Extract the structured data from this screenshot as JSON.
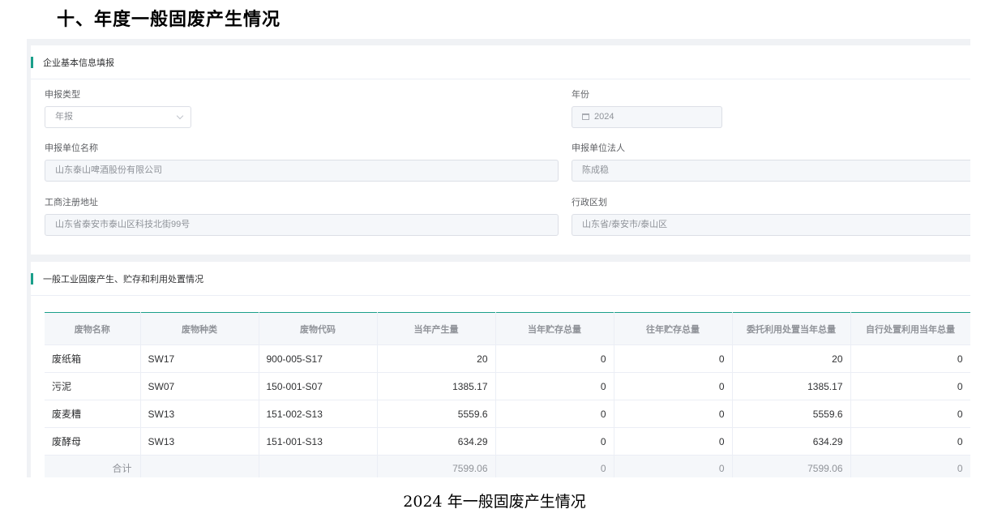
{
  "doc_heading": "十、年度一般固废产生情况",
  "caption": "2024 年一般固废产生情况",
  "basic_card": {
    "title": "企业基本信息填报",
    "report_type": {
      "label": "申报类型",
      "value": "年报"
    },
    "year": {
      "label": "年份",
      "value": "2024"
    },
    "company_name": {
      "label": "申报单位名称",
      "value": "山东泰山啤酒股份有限公司"
    },
    "legal_person": {
      "label": "申报单位法人",
      "value": "陈成稳"
    },
    "address": {
      "label": "工商注册地址",
      "value": "山东省泰安市泰山区科技北街99号"
    },
    "region": {
      "label": "行政区划",
      "value": "山东省/泰安市/泰山区"
    }
  },
  "waste_card": {
    "title": "一般工业固废产生、贮存和利用处置情况",
    "columns": [
      "废物名称",
      "废物种类",
      "废物代码",
      "当年产生量",
      "当年贮存总量",
      "往年贮存总量",
      "委托利用处置当年总量",
      "自行处置利用当年总量"
    ],
    "rows": [
      [
        "废纸箱",
        "SW17",
        "900-005-S17",
        "20",
        "0",
        "0",
        "20",
        "0"
      ],
      [
        "污泥",
        "SW07",
        "150-001-S07",
        "1385.17",
        "0",
        "0",
        "1385.17",
        "0"
      ],
      [
        "废麦糟",
        "SW13",
        "151-002-S13",
        "5559.6",
        "0",
        "0",
        "5559.6",
        "0"
      ],
      [
        "废酵母",
        "SW13",
        "151-001-S13",
        "634.29",
        "0",
        "0",
        "634.29",
        "0"
      ]
    ],
    "total": [
      "合计",
      "",
      "",
      "7599.06",
      "0",
      "0",
      "7599.06",
      "0"
    ]
  },
  "colors": {
    "accent": "#1a9f8a",
    "header_bg": "#f5f7fa"
  },
  "icons": {
    "select": "chevron-down-icon",
    "date": "calendar-icon"
  }
}
